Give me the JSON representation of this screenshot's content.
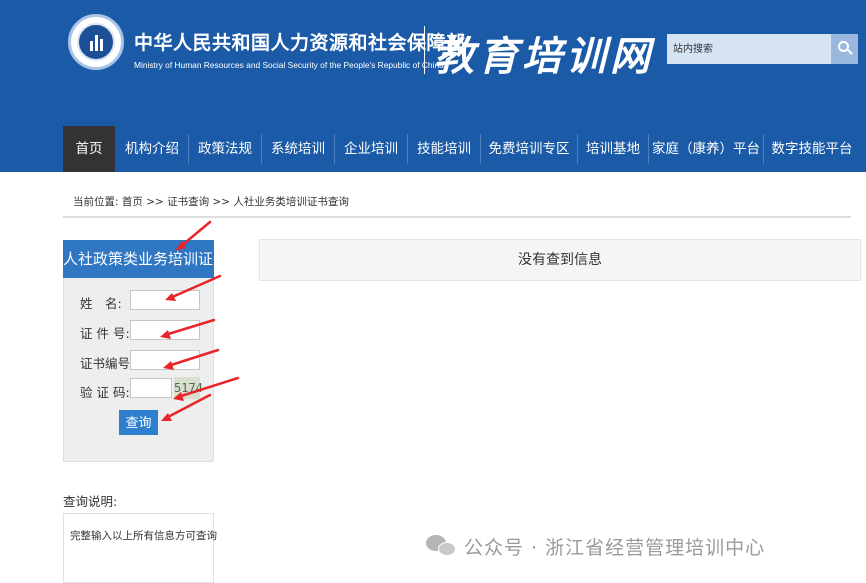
{
  "header": {
    "ministry_cn": "中华人民共和国人力资源和社会保障部",
    "ministry_en": "Ministry of Human Resources and Social Security of the People's Republic of China",
    "site_title": "教育培训网",
    "search_placeholder": "站内搜索",
    "emblem_icon": "ministry-emblem-icon"
  },
  "nav": {
    "items": [
      {
        "label": "首页",
        "active": true
      },
      {
        "label": "机构介绍"
      },
      {
        "label": "政策法规"
      },
      {
        "label": "系统培训"
      },
      {
        "label": "企业培训"
      },
      {
        "label": "技能培训"
      },
      {
        "label": "免费培训专区"
      },
      {
        "label": "培训基地"
      },
      {
        "label": "家庭（康养）平台"
      },
      {
        "label": "数字技能平台"
      }
    ]
  },
  "breadcrumb": "当前位置: 首页 >> 证书查询 >> 人社业务类培训证书查询",
  "query_panel": {
    "title": "人社政策类业务培训证书查",
    "fields": [
      {
        "label": "姓　名:",
        "value": ""
      },
      {
        "label": "证 件 号:",
        "value": ""
      },
      {
        "label": "证书编号:",
        "value": ""
      },
      {
        "label": "验 证 码:",
        "value": ""
      }
    ],
    "captcha": "5174",
    "submit_label": "查询"
  },
  "notes": {
    "title": "查询说明:",
    "text": "完整输入以上所有信息方可查询"
  },
  "result": {
    "message": "没有查到信息"
  },
  "watermark": {
    "text": "公众号 · 浙江省经营管理培训中心"
  },
  "colors": {
    "header_bg": "#1a5aa6",
    "nav_active": "#333333",
    "panel_title": "#2f76c3",
    "button": "#2f7fcf",
    "annotation": "#e8262a"
  }
}
